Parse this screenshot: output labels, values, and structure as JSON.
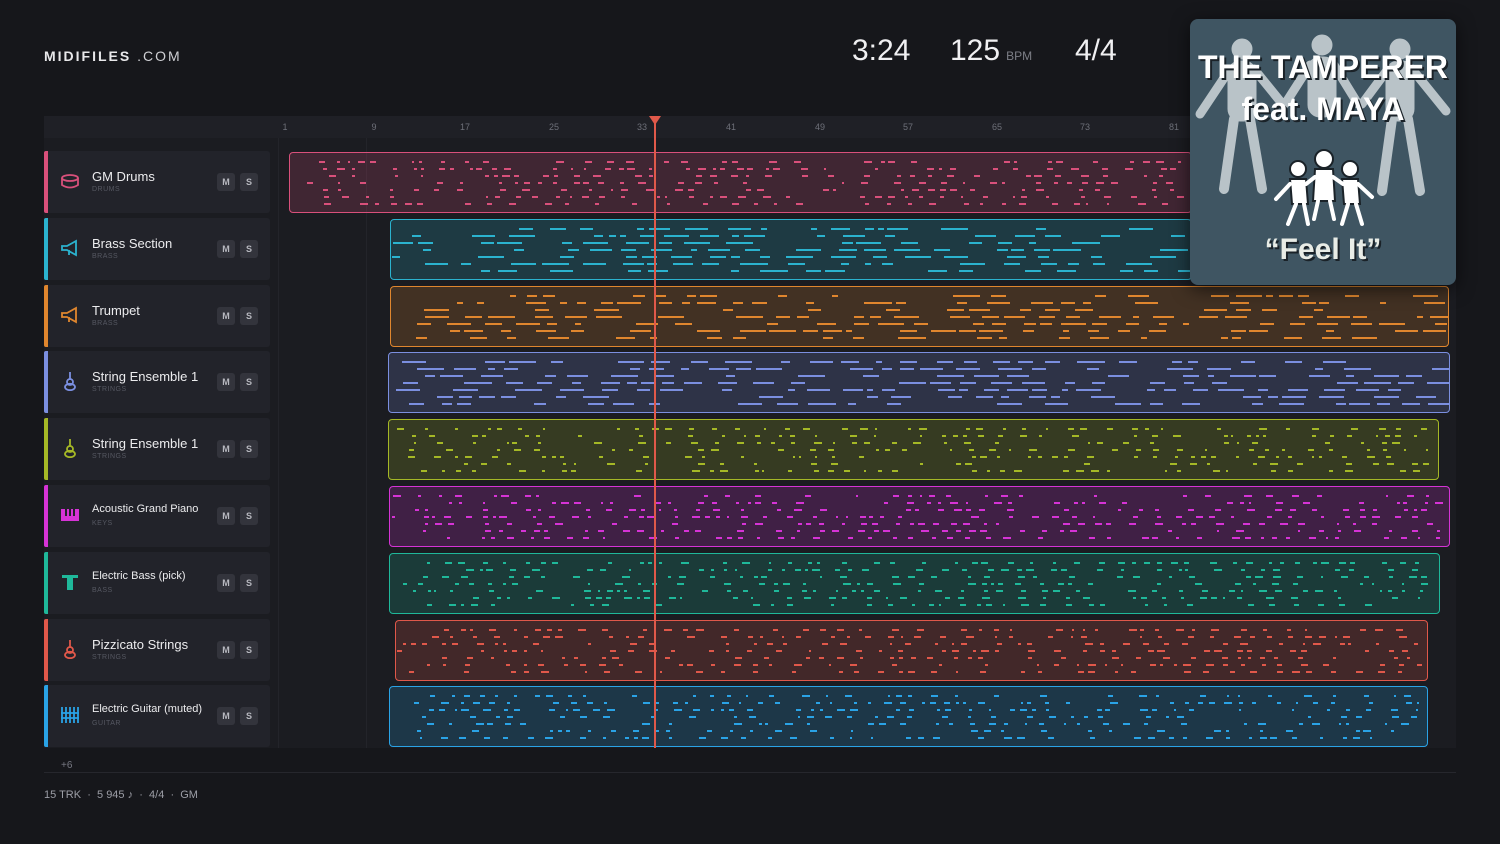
{
  "header": {
    "logo_bold": "MIDIFILES",
    "logo_light": ".COM",
    "time": "3:24",
    "tempo": "125",
    "tempo_unit": "BPM",
    "time_signature": "4/4"
  },
  "ruler": [
    "1",
    "9",
    "17",
    "25",
    "33",
    "41",
    "49",
    "57",
    "65",
    "73",
    "81"
  ],
  "tracks": [
    {
      "name": "GM Drums",
      "category": "DRUMS",
      "color": "#d9507b",
      "icon": "drum-icon"
    },
    {
      "name": "Brass Section",
      "category": "BRASS",
      "color": "#2bb3cf",
      "icon": "horn-icon"
    },
    {
      "name": "Trumpet",
      "category": "BRASS",
      "color": "#e0862e",
      "icon": "horn-icon"
    },
    {
      "name": "String Ensemble 1",
      "category": "STRINGS",
      "color": "#7b8fe0",
      "icon": "violin-icon"
    },
    {
      "name": "String Ensemble 1",
      "category": "STRINGS",
      "color": "#a5b826",
      "icon": "violin-icon"
    },
    {
      "name": "Acoustic Grand Piano",
      "category": "KEYS",
      "color": "#d633d6",
      "icon": "piano-icon"
    },
    {
      "name": "Electric Bass (pick)",
      "category": "BASS",
      "color": "#1fb89a",
      "icon": "bass-icon"
    },
    {
      "name": "Pizzicato Strings",
      "category": "STRINGS",
      "color": "#e0584a",
      "icon": "violin-icon"
    },
    {
      "name": "Electric Guitar (muted)",
      "category": "GUITAR",
      "color": "#2aa3e6",
      "icon": "guitar-icon"
    }
  ],
  "buttons": {
    "mute": "M",
    "solo": "S"
  },
  "album": {
    "line1": "THE TAMPERER",
    "line2": "feat. MAYA",
    "line3": "“Feel It”"
  },
  "more_tracks": "+6",
  "footer": {
    "tracks": "15 TRK",
    "notes": "5 945 ♪",
    "meter": "4/4",
    "standard": "GM",
    "sep": "·"
  }
}
